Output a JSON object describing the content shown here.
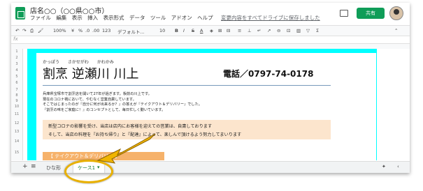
{
  "title_bar": {
    "doc_title": "店名○○（○○県○○市）",
    "menus": [
      "ファイル",
      "編集",
      "表示",
      "挿入",
      "表示形式",
      "データ",
      "ツール",
      "アドオン",
      "ヘルプ"
    ],
    "save_status": "変更内容をすべてドライブに保存しました",
    "share_label": "共有"
  },
  "toolbar": {
    "zoom": "100%",
    "currency": "¥",
    "percent": "%",
    "dec_less": ".0",
    "dec_more": ".00",
    "number_format": "123",
    "font": "デフォルト...",
    "font_size": "10",
    "bold": "B",
    "italic": "I",
    "strike": "S",
    "text_color": "A"
  },
  "formula_bar": {
    "fx": "fx"
  },
  "row_numbers": [
    "1",
    "2",
    "3",
    "4",
    "5",
    "6",
    "7",
    "8",
    "9",
    "10",
    "11",
    "12",
    "13",
    "14",
    "15"
  ],
  "sheet": {
    "furigana": "かっぽう さかせがわ かわかみ",
    "restaurant_name": "割烹 逆瀬川 川上",
    "phone": "電話／0797-74-0178",
    "intro_lines": [
      "兵庫県宝塚市で割烹店を開いて27年が過ぎます。板前の川上です。",
      "現在のコロナ禍において、やむなく営業自粛しています。",
      "そこではじまったのが『自分に何が出来るか？』の答えが『テイクアウト＆デリバリー』でした。",
      "『割烹の味をご家庭に！』のコンセプトとして、毎日忙しく動いています。"
    ],
    "notice_lines": [
      "新型コロナの影響を受け、当店は店内にお客様を迎えての営業は、自粛しております",
      "そして、当店の料理を『お持ち帰り』と『配達』によって、楽しんで頂けるよう努力してまいります"
    ],
    "takeout_label": "【 テイクアウト＆デリバリー 】"
  },
  "sheet_tabs": {
    "add": "+",
    "list": "≡",
    "tab_1": "ひな形",
    "tab_2": "ケース1",
    "tab_2_caret": "▾"
  },
  "colors": {
    "accent_cyan": "#00ffff",
    "notice_bg": "#fce5cd",
    "takeout_bg": "#f6b26b",
    "share_green": "#0f9d58",
    "annotation_yellow": "#e8b000"
  }
}
